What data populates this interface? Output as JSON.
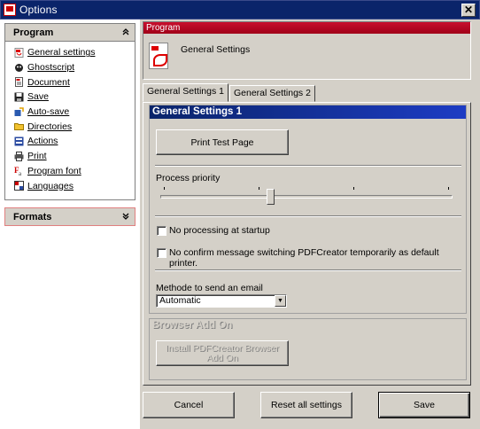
{
  "window": {
    "title": "Options",
    "close_glyph": "✕"
  },
  "sidebar": {
    "program_panel": {
      "title": "Program",
      "collapse_glyph": "⌃",
      "items": [
        {
          "label": "General settings",
          "icon": "general-settings-icon",
          "active": true
        },
        {
          "label": "Ghostscript",
          "icon": "ghostscript-icon"
        },
        {
          "label": "Document",
          "icon": "document-icon"
        },
        {
          "label": "Save",
          "icon": "save-icon"
        },
        {
          "label": "Auto-save",
          "icon": "auto-save-icon"
        },
        {
          "label": "Directories",
          "icon": "folder-icon"
        },
        {
          "label": "Actions",
          "icon": "actions-icon"
        },
        {
          "label": "Print",
          "icon": "printer-icon"
        },
        {
          "label": "Program font",
          "icon": "font-icon"
        },
        {
          "label": "Languages",
          "icon": "languages-icon"
        }
      ]
    },
    "formats_panel": {
      "title": "Formats",
      "expand_glyph": "⌄"
    }
  },
  "program_header": {
    "section": "Program",
    "title": "General Settings",
    "accent": "#c8102e"
  },
  "tabs": [
    {
      "label": "General Settings 1",
      "active": true
    },
    {
      "label": "General Settings 2",
      "active": false
    }
  ],
  "general_settings_1": {
    "group_title": "General Settings 1",
    "print_test_page": "Print Test Page",
    "process_priority_label": "Process priority",
    "process_priority_level": 0.38,
    "no_processing_label": "No processing at startup",
    "no_processing_checked": false,
    "no_confirm_label": "No confirm message switching PDFCreator temporarily as default printer.",
    "no_confirm_checked": false,
    "email_method_label": "Methode to send an email",
    "email_method_value": "Automatic"
  },
  "browser_addon": {
    "group_title": "Browser Add On",
    "install_button": "Install PDFCreator Browser Add On"
  },
  "footer": {
    "cancel": "Cancel",
    "reset": "Reset all settings",
    "save": "Save"
  },
  "colors": {
    "titlebar": "#0a246a",
    "group_header": "#0a246a",
    "program_bar": "#c8102e",
    "face": "#d4d0c8"
  }
}
